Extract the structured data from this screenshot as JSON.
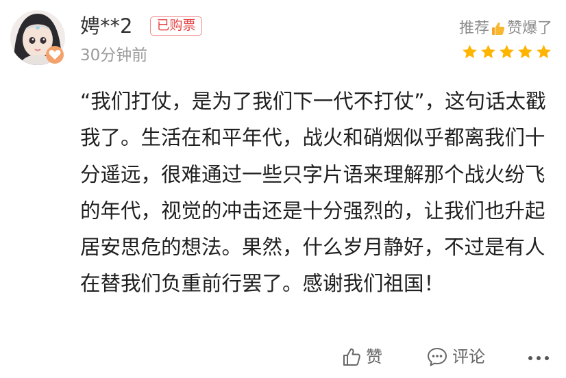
{
  "review": {
    "username": "娉**2",
    "badge": "已购票",
    "time": "30分钟前",
    "recommend_prefix": "推荐",
    "recommend_suffix": "赞爆了",
    "rating": 5,
    "content": "“我们打仗，是为了我们下一代不打仗”，这句话太戳我了。生活在和平年代，战火和硝烟似乎都离我们十分遥远，很难通过一些只字片语来理解那个战火纷飞的年代，视觉的冲击还是十分强烈的，让我们也升起居安思危的想法。果然，什么岁月静好，不过是有人在替我们负重前行罢了。感谢我们祖国！"
  },
  "actions": {
    "like_label": "赞",
    "comment_label": "评论"
  },
  "colors": {
    "star": "#ffb400",
    "badge_text": "#e64545",
    "badge_border": "#ef8a8a",
    "muted_text": "#9a9a9a"
  },
  "icons": [
    "avatar",
    "thumbs-up-icon",
    "star-icon",
    "like-icon",
    "comment-icon",
    "more-icon"
  ]
}
